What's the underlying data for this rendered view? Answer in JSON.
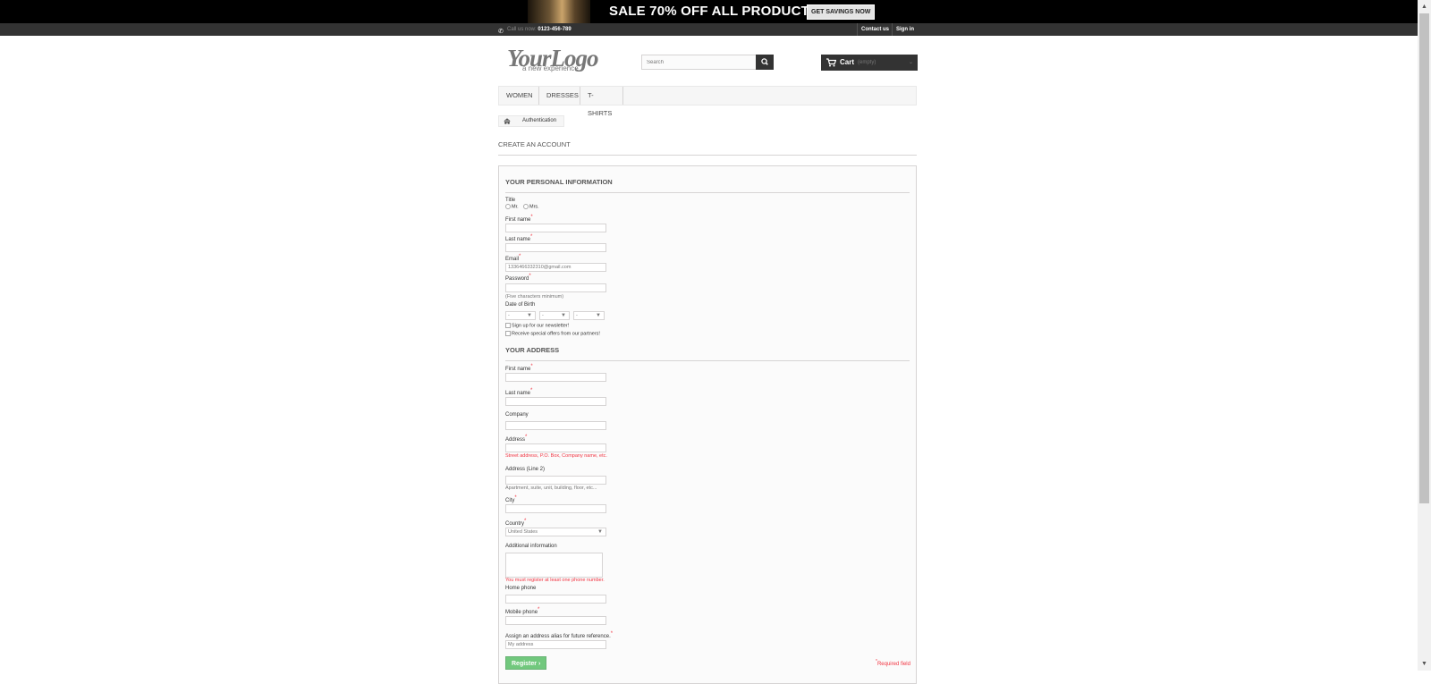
{
  "banner": {
    "text": "SALE 70% OFF ALL PRODUCTS",
    "button": "GET SAVINGS NOW"
  },
  "topbar": {
    "call_prefix": "Call us now:",
    "phone": "0123-456-789",
    "contact": "Contact us",
    "signin": "Sign in"
  },
  "logo": {
    "main": "YourLogo",
    "tagline": "a new experience"
  },
  "search": {
    "placeholder": "Search"
  },
  "cart": {
    "label": "Cart",
    "status": "(empty)"
  },
  "nav": {
    "items": [
      "WOMEN",
      "DRESSES",
      "T-SHIRTS"
    ]
  },
  "breadcrumb": {
    "current": "Authentication"
  },
  "page": {
    "heading": "CREATE AN ACCOUNT"
  },
  "personal": {
    "title": "YOUR PERSONAL INFORMATION",
    "title_label": "Title",
    "mr": "Mr.",
    "mrs": "Mrs.",
    "first_name": "First name",
    "last_name": "Last name",
    "email": "Email",
    "email_value": "1336466332310@gmail.com",
    "password": "Password",
    "password_hint": "(Five characters minimum)",
    "dob": "Date of Birth",
    "dob_day": "-",
    "dob_month": "-",
    "dob_year": "-",
    "newsletter": "Sign up for our newsletter!",
    "offers": "Receive special offers from our partners!"
  },
  "address": {
    "title": "YOUR ADDRESS",
    "first_name": "First name",
    "last_name": "Last name",
    "company": "Company",
    "address": "Address",
    "address_hint": "Street address, P.O. Box, Company name, etc.",
    "address2": "Address (Line 2)",
    "address2_hint": "Apartment, suite, unit, building, floor, etc...",
    "city": "City",
    "country": "Country",
    "country_value": "United States",
    "additional": "Additional information",
    "phone_warning": "You must register at least one phone number.",
    "home_phone": "Home phone",
    "mobile_phone": "Mobile phone",
    "alias": "Assign an address alias for future reference.",
    "alias_placeholder": "My address"
  },
  "actions": {
    "register": "Register",
    "required_note": "Required field"
  },
  "colors": {
    "accent_red": "#f13340",
    "dark": "#333333",
    "register_green": "#43b754"
  }
}
